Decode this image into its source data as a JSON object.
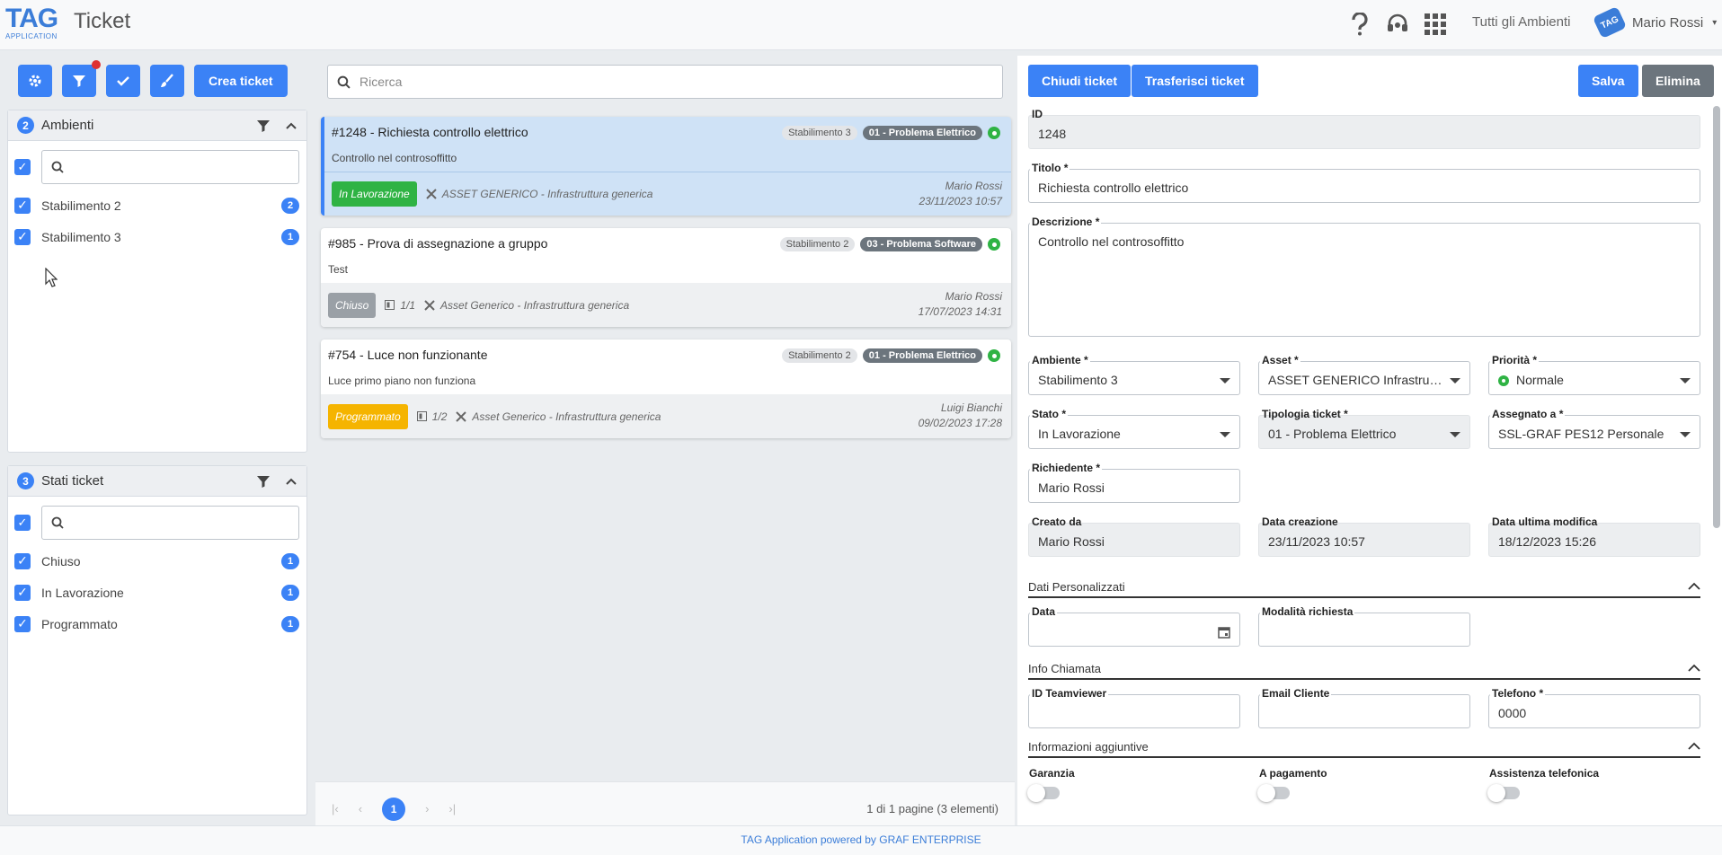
{
  "header": {
    "logo_text": "TAG",
    "logo_sub": "APPLICATION",
    "title": "Ticket",
    "env_link": "Tutti gli Ambienti",
    "user_badge": "TAG",
    "user_name": "Mario Rossi"
  },
  "toolbar": {
    "create_label": "Crea ticket"
  },
  "filters": {
    "ambienti": {
      "count": "2",
      "title": "Ambienti",
      "items": [
        {
          "label": "Stabilimento 2",
          "count": "2"
        },
        {
          "label": "Stabilimento 3",
          "count": "1"
        }
      ]
    },
    "stati": {
      "count": "3",
      "title": "Stati ticket",
      "items": [
        {
          "label": "Chiuso",
          "count": "1"
        },
        {
          "label": "In Lavorazione",
          "count": "1"
        },
        {
          "label": "Programmato",
          "count": "1"
        }
      ]
    }
  },
  "search": {
    "placeholder": "Ricerca"
  },
  "tickets": [
    {
      "title": "#1248 - Richiesta controllo elettrico",
      "description": "Controllo nel controsoffitto",
      "env": "Stabilimento 3",
      "type": "01 - Problema Elettrico",
      "state": "In Lavorazione",
      "state_color": "#2fb344",
      "tasks": "",
      "asset": "ASSET GENERICO - Infrastruttura generica",
      "user": "Mario Rossi",
      "date": "23/11/2023 10:57"
    },
    {
      "title": "#985 - Prova di assegnazione a gruppo",
      "description": "Test",
      "env": "Stabilimento 2",
      "type": "03 - Problema Software",
      "state": "Chiuso",
      "state_color": "#9aa0a6",
      "tasks": "1/1",
      "asset": "Asset Generico - Infrastruttura generica",
      "user": "Mario Rossi",
      "date": "17/07/2023 14:31"
    },
    {
      "title": "#754 - Luce non funzionante",
      "description": "Luce primo piano non funziona",
      "env": "Stabilimento 2",
      "type": "01 - Problema Elettrico",
      "state": "Programmato",
      "state_color": "#f5b400",
      "tasks": "1/2",
      "asset": "Asset Generico - Infrastruttura generica",
      "user": "Luigi Bianchi",
      "date": "09/02/2023 17:28"
    }
  ],
  "pager": {
    "current": "1",
    "info": "1 di 1 pagine (3 elementi)"
  },
  "form": {
    "buttons": {
      "close": "Chiudi ticket",
      "transfer": "Trasferisci ticket",
      "save": "Salva",
      "delete": "Elimina"
    },
    "id": {
      "label": "ID",
      "value": "1248"
    },
    "titolo": {
      "label": "Titolo *",
      "value": "Richiesta controllo elettrico"
    },
    "descrizione": {
      "label": "Descrizione *",
      "value": "Controllo nel controsoffitto"
    },
    "ambiente": {
      "label": "Ambiente *",
      "value": "Stabilimento 3"
    },
    "asset": {
      "label": "Asset *",
      "value": "ASSET GENERICO Infrastruttura generica"
    },
    "priorita": {
      "label": "Priorità *",
      "value": "Normale"
    },
    "stato": {
      "label": "Stato *",
      "value": "In Lavorazione"
    },
    "tipologia": {
      "label": "Tipologia ticket *",
      "value": "01 - Problema Elettrico"
    },
    "assegnato": {
      "label": "Assegnato a *",
      "value": "SSL-GRAF PES12 Personale"
    },
    "richiedente": {
      "label": "Richiedente *",
      "value": "Mario Rossi"
    },
    "creato_da": {
      "label": "Creato da",
      "value": "Mario Rossi"
    },
    "data_creazione": {
      "label": "Data creazione",
      "value": "23/11/2023 10:57"
    },
    "data_modifica": {
      "label": "Data ultima modifica",
      "value": "18/12/2023 15:26"
    },
    "sections": {
      "dati": "Dati Personalizzati",
      "info": "Info Chiamata",
      "aggiuntive": "Informazioni aggiuntive"
    },
    "data": {
      "label": "Data",
      "value": ""
    },
    "modalita": {
      "label": "Modalità richiesta",
      "value": ""
    },
    "teamviewer": {
      "label": "ID Teamviewer",
      "value": ""
    },
    "email": {
      "label": "Email Cliente",
      "value": ""
    },
    "telefono": {
      "label": "Telefono *",
      "value": "0000"
    },
    "toggles": {
      "garanzia": "Garanzia",
      "pagamento": "A pagamento",
      "assistenza": "Assistenza telefonica"
    }
  },
  "footer": {
    "text": "TAG Application powered by GRAF ENTERPRISE"
  }
}
